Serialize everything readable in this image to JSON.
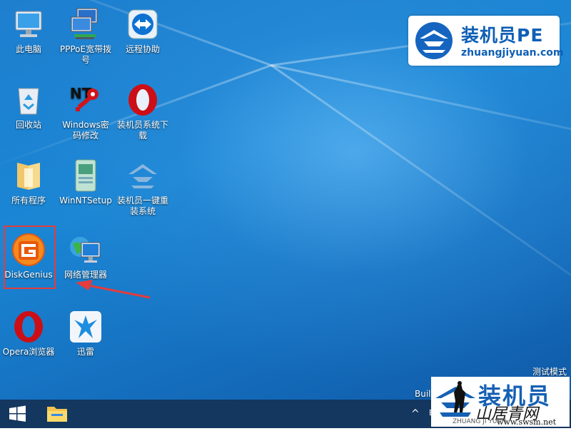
{
  "desktop": {
    "icons": [
      {
        "id": "this-pc",
        "label": "此电脑"
      },
      {
        "id": "pppoe",
        "label": "PPPoE宽带拨号"
      },
      {
        "id": "teamviewer",
        "label": "远程协助"
      },
      {
        "id": "recycle-bin",
        "label": "回收站"
      },
      {
        "id": "windows-password",
        "label": "Windows密码修改"
      },
      {
        "id": "download",
        "label": "装机员系统下载"
      },
      {
        "id": "all-programs",
        "label": "所有程序"
      },
      {
        "id": "winntsetup",
        "label": "WinNTSetup"
      },
      {
        "id": "reinstall",
        "label": "装机员一键重装系统"
      },
      {
        "id": "diskgenius",
        "label": "DiskGenius"
      },
      {
        "id": "network-manager",
        "label": "网络管理器"
      },
      {
        "id": "opera",
        "label": "Opera浏览器"
      },
      {
        "id": "xunlei",
        "label": "迅雷"
      }
    ]
  },
  "logo": {
    "title": "装机员PE",
    "url": "zhuangjiyuan.com"
  },
  "status": {
    "test_mode": "测试模式",
    "build": "Buil"
  },
  "tray": {
    "arrow": "^",
    "partial": "E"
  },
  "watermark": {
    "brand": "装机员",
    "script": "山居青网",
    "url": "www.swsm.net",
    "zh": "ZHUANG JI YUAN"
  },
  "colors": {
    "highlight": "#e53c3c",
    "accent": "#0f5fb5",
    "taskbar": "#13375f"
  }
}
